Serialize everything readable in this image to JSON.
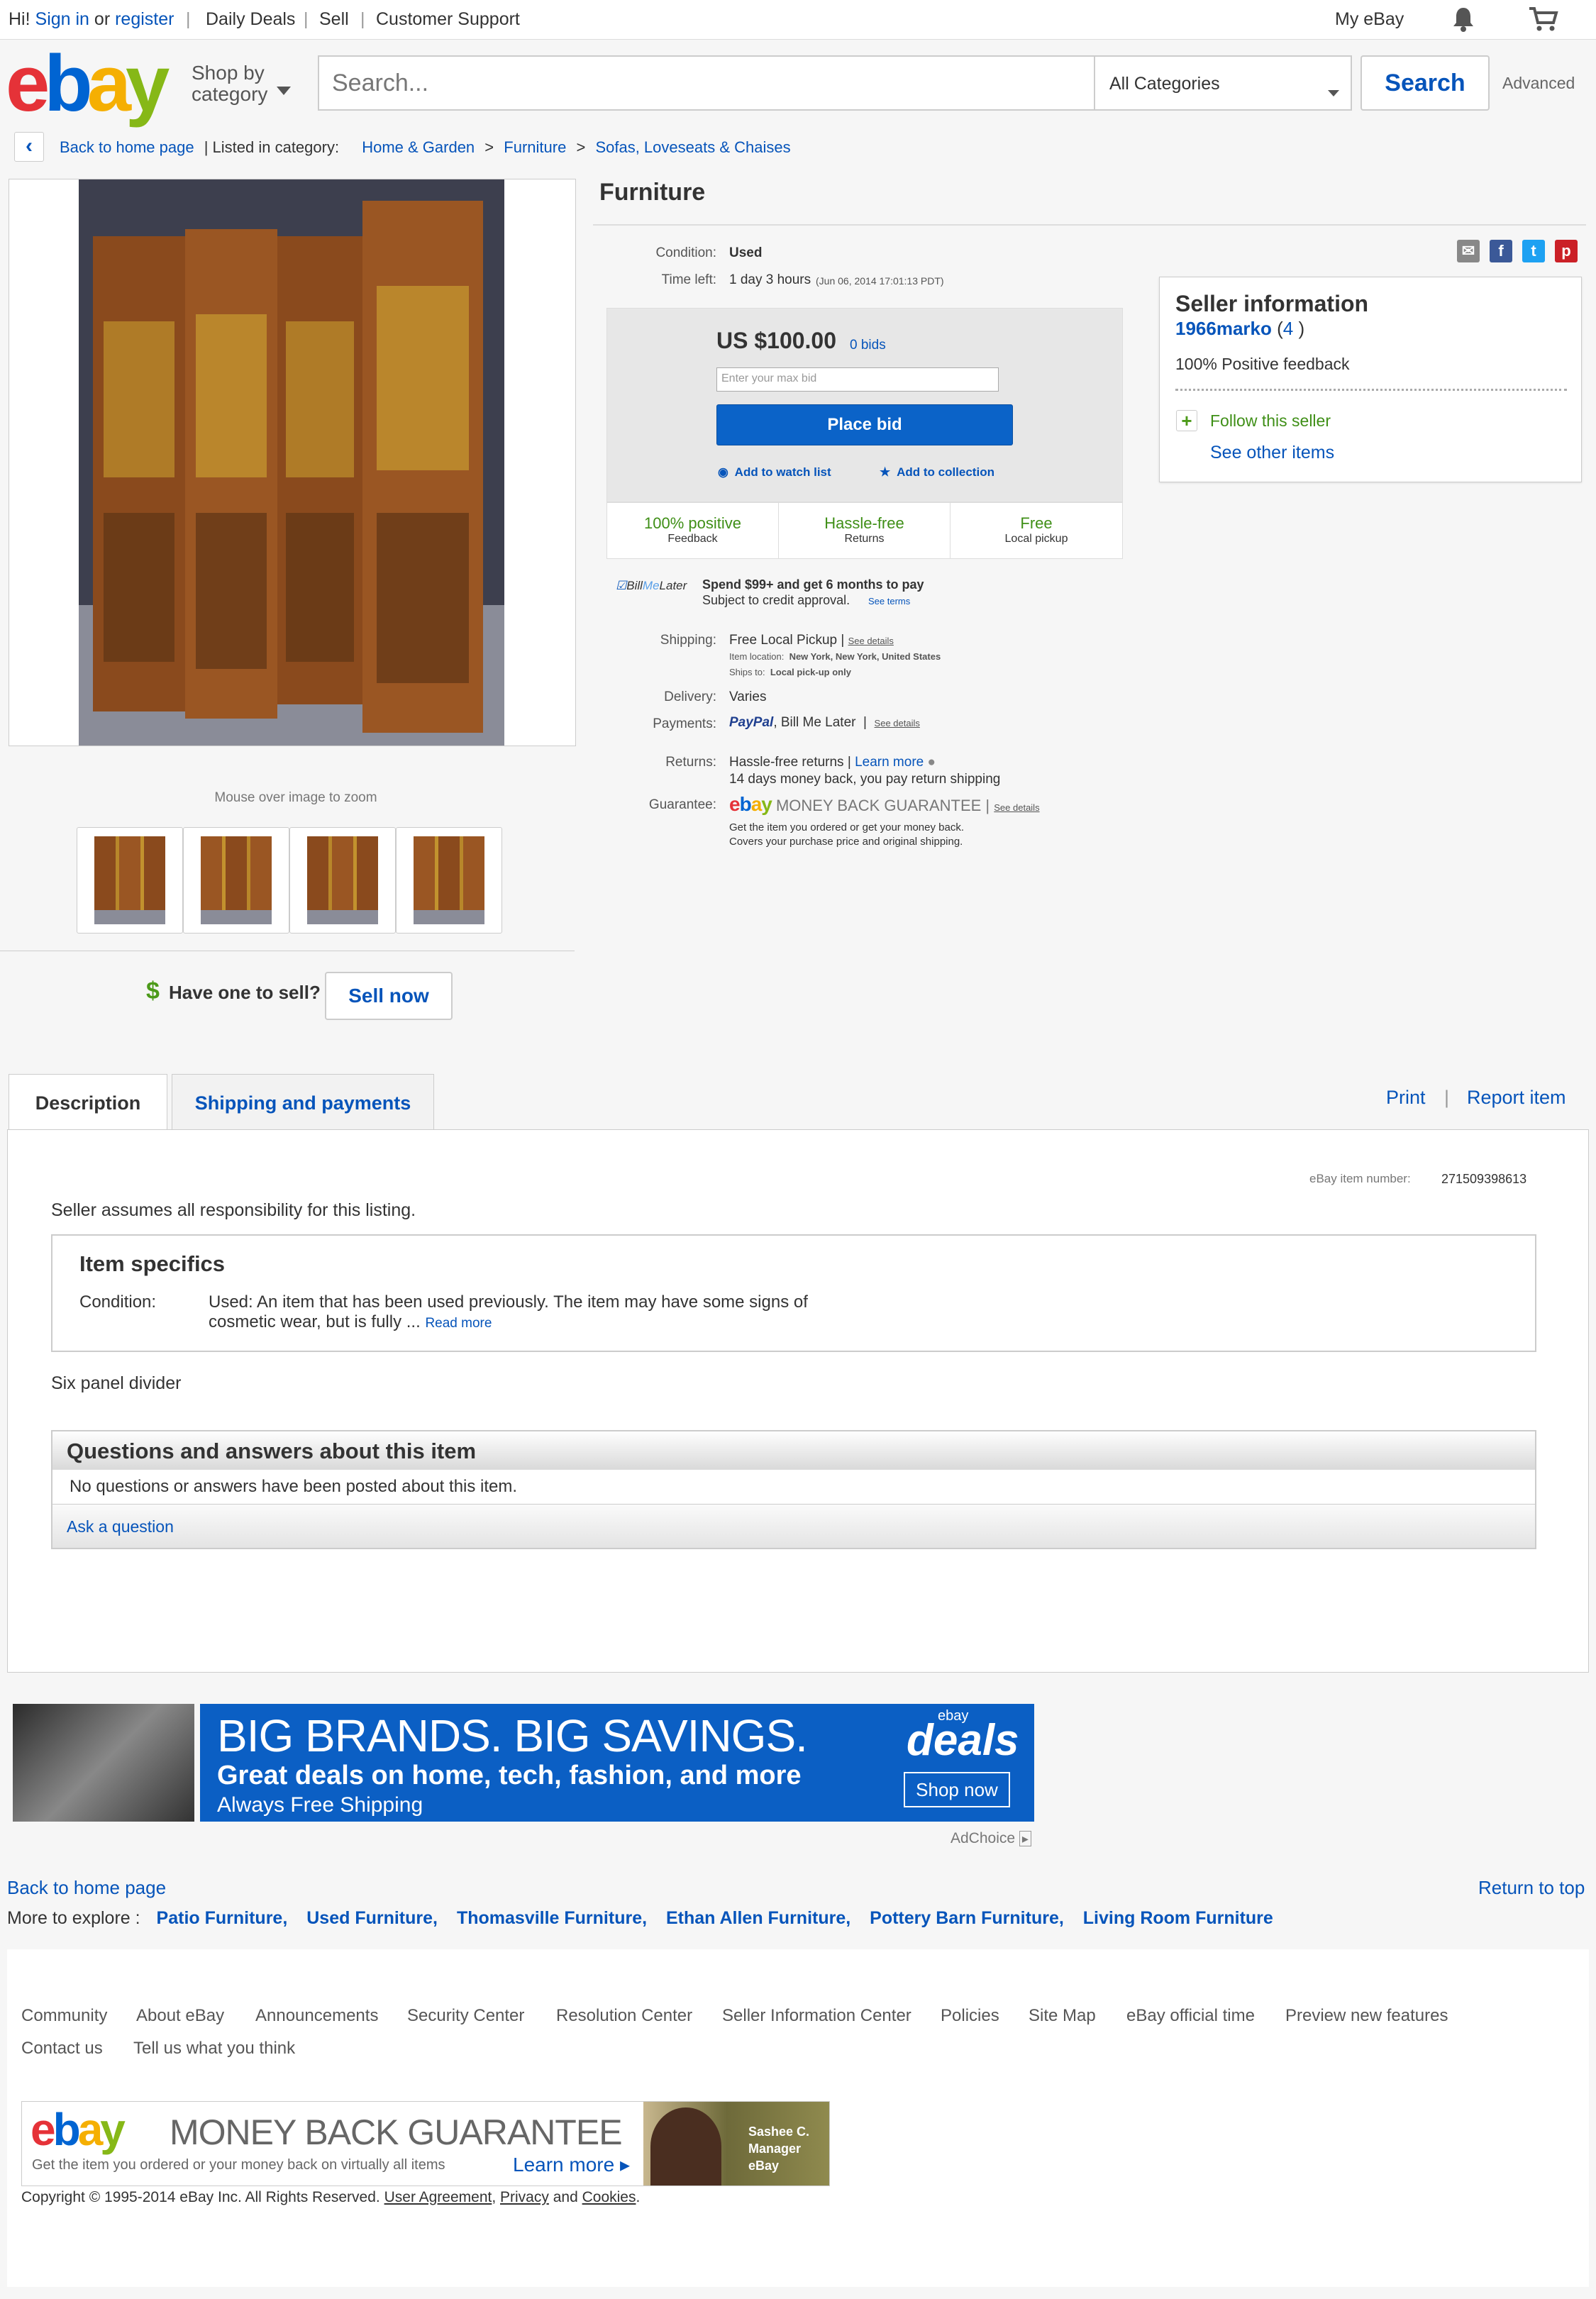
{
  "topbar": {
    "greeting": "Hi!",
    "sign_in": "Sign in",
    "or": "or",
    "register": "register",
    "links": [
      "Daily Deals",
      "Sell",
      "Customer Support"
    ],
    "my_ebay": "My eBay"
  },
  "header": {
    "logo": [
      "e",
      "b",
      "a",
      "y"
    ],
    "shop_by": "Shop by",
    "category": "category",
    "search_placeholder": "Search...",
    "category_select": "All Categories",
    "search_button": "Search",
    "advanced": "Advanced"
  },
  "breadcrumb": {
    "back": "Back to home page",
    "listed_in": "| Listed in category:",
    "items": [
      "Home & Garden",
      "Furniture",
      "Sofas, Loveseats & Chaises"
    ],
    "separator": ">"
  },
  "gallery": {
    "zoom_text": "Mouse over image to zoom",
    "have_one": "Have one to sell?",
    "sell_now": "Sell now",
    "dollar_icon": "$"
  },
  "item": {
    "title": "Furniture",
    "condition_label": "Condition:",
    "condition_value": "Used",
    "time_left_label": "Time left:",
    "time_left_value": "1 day 3 hours",
    "time_left_date": "(Jun 06, 2014   17:01:13 PDT)",
    "price": "US $100.00",
    "bids": "0 bids",
    "max_bid_placeholder": "Enter your max bid",
    "place_bid": "Place bid",
    "watch_list": "Add to watch list",
    "collection": "Add to collection",
    "badges": [
      {
        "big": "100% positive",
        "small": "Feedback"
      },
      {
        "big": "Hassle-free",
        "small": "Returns"
      },
      {
        "big": "Free",
        "small": "Local pickup"
      }
    ],
    "bml_brand_a": "Bill",
    "bml_brand_b": "Me",
    "bml_brand_c": "Later",
    "bml_offer": "Spend $99+ and get 6 months to pay",
    "bml_subject": "Subject to credit approval.",
    "bml_terms": "See terms",
    "shipping_label": "Shipping:",
    "shipping_value": "Free Local Pickup",
    "see_details": "See details",
    "item_location_label": "Item location:",
    "item_location_value": "New York, New York, United States",
    "ships_to_label": "Ships to:",
    "ships_to_value": "Local pick-up only",
    "delivery_label": "Delivery:",
    "delivery_value": "Varies",
    "payments_label": "Payments:",
    "paypal": "PayPal",
    "payments_value": ", Bill Me Later",
    "returns_label": "Returns:",
    "returns_value": "Hassle-free returns",
    "learn_more": "Learn more",
    "returns_detail": "14 days money back, you pay return shipping",
    "guarantee_label": "Guarantee:",
    "guarantee_text": "MONEY BACK GUARANTEE",
    "guarantee_line1": "Get the item you ordered or get your money back.",
    "guarantee_line2": "Covers your purchase price and original shipping."
  },
  "seller": {
    "heading": "Seller information",
    "name": "1966marko",
    "score": "4",
    "feedback": "100% Positive feedback",
    "follow": "Follow this seller",
    "see_other": "See other items"
  },
  "tabs": {
    "description": "Description",
    "shipping": "Shipping and payments",
    "print": "Print",
    "report": "Report item"
  },
  "description": {
    "item_number_label": "eBay item number:",
    "item_number": "271509398613",
    "assumes": "Seller assumes all responsibility for this listing.",
    "specifics_title": "Item specifics",
    "condition_label": "Condition:",
    "condition_text": "Used: An item that has been used previously. The item may have some signs of cosmetic wear, but is fully ...",
    "read_more": "Read more",
    "body": "Six panel divider",
    "qa_title": "Questions and answers about this item",
    "qa_none": "No questions or answers have been posted about this item.",
    "ask": "Ask a question"
  },
  "ad": {
    "line1": "BIG BRANDS. BIG SAVINGS.",
    "line2": "Great deals on home, tech, fashion, and more",
    "line3": "Always Free Shipping",
    "brand_small": "ebay",
    "brand_big": "deals",
    "shop_now": "Shop now",
    "adchoice": "AdChoice"
  },
  "footer": {
    "back_home": "Back to home page",
    "return_top": "Return to top",
    "explore_label": "More to explore :",
    "explore": [
      "Patio Furniture,",
      "Used Furniture,",
      "Thomasville Furniture,",
      "Ethan Allen Furniture,",
      "Pottery Barn Furniture,",
      "Living Room Furniture"
    ],
    "links": [
      "Community",
      "About eBay",
      "Announcements",
      "Security Center",
      "Resolution Center",
      "Seller Information Center",
      "Policies",
      "Site Map",
      "eBay official time",
      "Preview new features"
    ],
    "links2": [
      "Contact us",
      "Tell us what you think"
    ],
    "mbg_title": "MONEY BACK GUARANTEE",
    "mbg_sub": "Get the item you ordered or your money back on virtually all items",
    "mbg_learn": "Learn more",
    "mbg_person": "Sashee C.",
    "mbg_role": "Manager",
    "mbg_company": "eBay",
    "copyright": "Copyright © 1995-2014 eBay Inc. All Rights Reserved.",
    "user_agreement": "User Agreement",
    "privacy": "Privacy",
    "and": "and",
    "cookies": "Cookies"
  },
  "colors": {
    "link": "#0654ba",
    "green": "#3f8f17",
    "bid_button": "#0b63c8",
    "ad_blue": "#0b5fc4"
  }
}
